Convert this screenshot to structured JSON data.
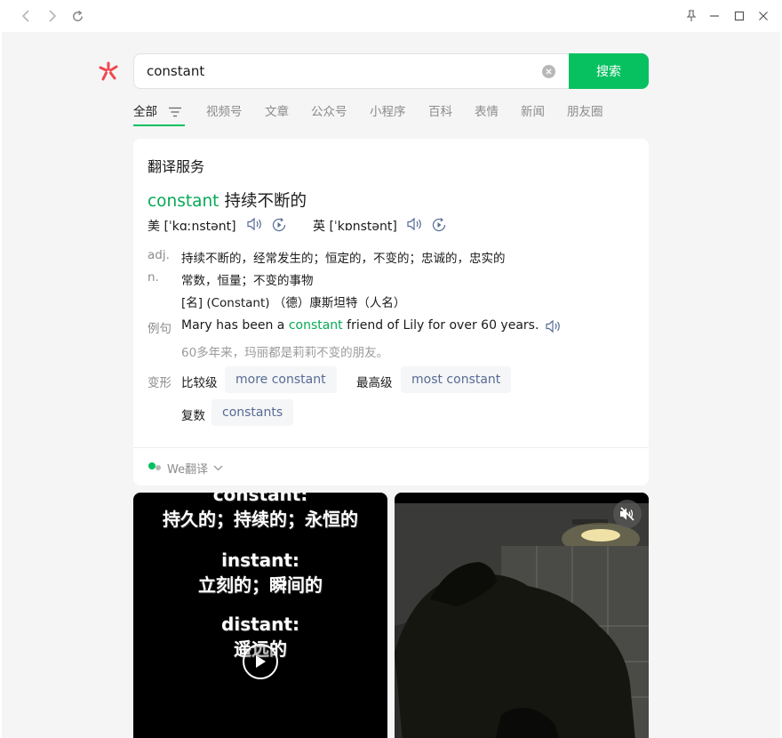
{
  "search": {
    "query": "constant",
    "button_label": "搜索"
  },
  "tabs": [
    {
      "label": "全部"
    },
    {
      "label": "视频号"
    },
    {
      "label": "文章"
    },
    {
      "label": "公众号"
    },
    {
      "label": "小程序"
    },
    {
      "label": "百科"
    },
    {
      "label": "表情"
    },
    {
      "label": "新闻"
    },
    {
      "label": "朋友圈"
    }
  ],
  "translation": {
    "card_title": "翻译服务",
    "word": "constant",
    "word_meaning": "持续不断的",
    "pron_us_label": "美 [ˈkɑːnstənt]",
    "pron_uk_label": "英 [ˈkɒnstənt]",
    "pos_adj": "adj.",
    "def_adj": "持续不断的，经常发生的；恒定的，不变的；忠诚的，忠实的",
    "pos_n": "n.",
    "def_n_1": "常数，恒量；不变的事物",
    "def_n_2": "[名] (Constant) （德）康斯坦特（人名）",
    "example_label": "例句",
    "example_before": "Mary has been a ",
    "example_keyword": "constant",
    "example_after": " friend of Lily for over 60 years.",
    "example_translation": "60多年来，玛丽都是莉莉不变的朋友。",
    "forms_label": "变形",
    "comparative_label": "比较级",
    "comparative_value": "more constant",
    "superlative_label": "最高级",
    "superlative_value": "most constant",
    "plural_label": "复数",
    "plural_value": "constants",
    "footer_label": "We翻译"
  },
  "videos": [
    {
      "caption_lines": [
        "constant:",
        "持久的；持续的；永恒的",
        "instant:",
        "立刻的；瞬间的",
        "distant:",
        "遥远的"
      ]
    },
    {
      "caption_lines": []
    }
  ],
  "colors": {
    "accent": "#07c160",
    "link": "#576b95",
    "keyword": "#07a957"
  }
}
